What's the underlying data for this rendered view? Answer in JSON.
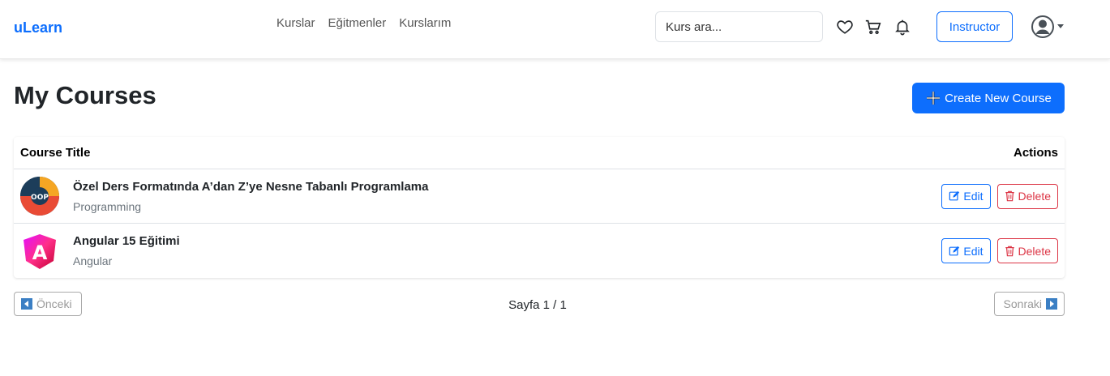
{
  "navbar": {
    "brand": "uLearn",
    "links": [
      "Kurslar",
      "Eğitmenler",
      "Kurslarım"
    ],
    "search_placeholder": "Kurs ara...",
    "instructor_label": "Instructor",
    "icons": [
      "heart-icon",
      "cart-icon",
      "bell-icon",
      "user-circle-icon"
    ]
  },
  "page": {
    "title": "My Courses",
    "create_label": "Create New Course"
  },
  "table": {
    "columns": [
      "Course Title",
      "Actions"
    ],
    "rows": [
      {
        "title": "Özel Ders Formatında A’dan Z’ye Nesne Tabanlı Programlama",
        "category": "Programming",
        "thumb_text": "OOP",
        "edit_label": "Edit",
        "delete_label": "Delete"
      },
      {
        "title": "Angular 15 Eğitimi",
        "category": "Angular",
        "thumb_text": "A",
        "edit_label": "Edit",
        "delete_label": "Delete"
      }
    ]
  },
  "pagination": {
    "prev_label": "Önceki",
    "page_text": "Sayfa 1 / 1",
    "next_label": "Sonraki"
  },
  "colors": {
    "primary": "#0d6efd",
    "danger": "#dc3545",
    "muted": "#6c757d"
  }
}
